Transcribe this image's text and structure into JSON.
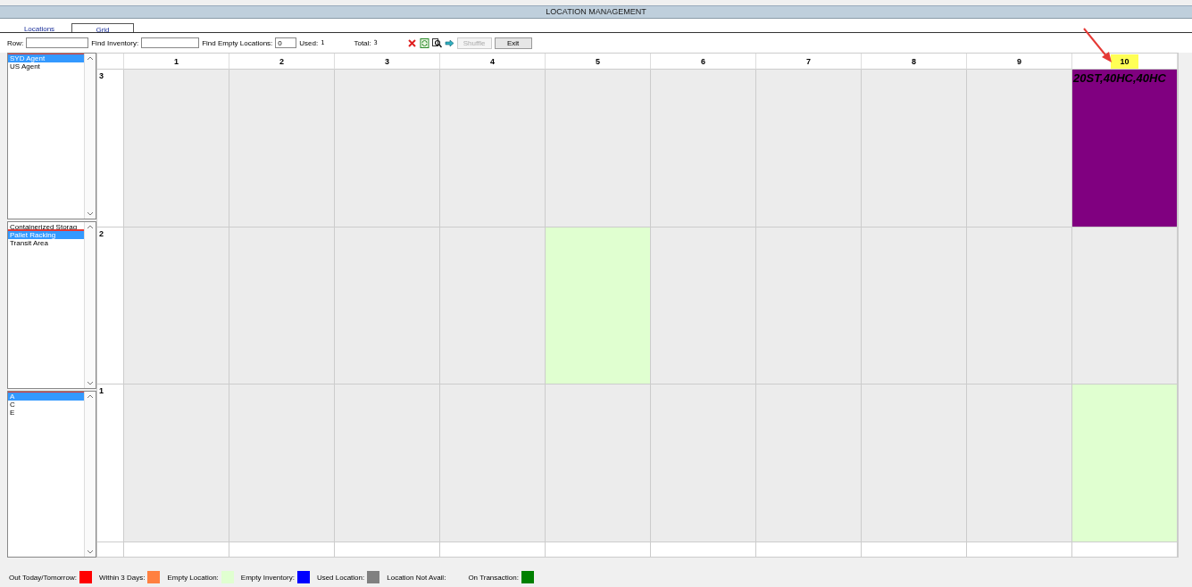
{
  "window": {
    "title": "LOCATION MANAGEMENT"
  },
  "tabs": [
    {
      "label": "Locations",
      "selected": false
    },
    {
      "label": "Grid",
      "selected": true
    }
  ],
  "toolbar": {
    "row_label": "Row:",
    "find_inventory_label": "Find Inventory:",
    "find_empty_label": "Find Empty Locations:",
    "find_empty_value": "0",
    "used_label": "Used:",
    "used_value": "1",
    "total_label": "Total:",
    "total_value": "3",
    "shuffle": {
      "label": "Shuffle",
      "disabled": true
    },
    "exit": {
      "label": "Exit",
      "disabled": false
    }
  },
  "lists": [
    {
      "items": [
        {
          "label": "SYD Agent",
          "selected": true,
          "highlighted": true
        },
        {
          "label": "US Agent",
          "selected": false,
          "highlighted": false
        }
      ]
    },
    {
      "items": [
        {
          "label": "Containerized Storag",
          "selected": false,
          "highlighted": false
        },
        {
          "label": "Pallet Racking",
          "selected": true,
          "highlighted": true
        },
        {
          "label": "Transit Area",
          "selected": false,
          "highlighted": false
        }
      ]
    },
    {
      "items": [
        {
          "label": "A",
          "selected": true,
          "highlighted": true
        },
        {
          "label": "C",
          "selected": false,
          "highlighted": false
        },
        {
          "label": "E",
          "selected": false,
          "highlighted": false
        }
      ]
    }
  ],
  "grid": {
    "columns": [
      {
        "label": "1",
        "highlighted": false
      },
      {
        "label": "2",
        "highlighted": false
      },
      {
        "label": "3",
        "highlighted": false
      },
      {
        "label": "4",
        "highlighted": false
      },
      {
        "label": "5",
        "highlighted": false
      },
      {
        "label": "6",
        "highlighted": false
      },
      {
        "label": "7",
        "highlighted": false
      },
      {
        "label": "8",
        "highlighted": false
      },
      {
        "label": "9",
        "highlighted": false
      },
      {
        "label": "10",
        "highlighted": true
      }
    ],
    "rows": [
      {
        "label": "3",
        "cells": [
          {
            "kind": "free"
          },
          {
            "kind": "free"
          },
          {
            "kind": "free"
          },
          {
            "kind": "free"
          },
          {
            "kind": "free"
          },
          {
            "kind": "free"
          },
          {
            "kind": "free"
          },
          {
            "kind": "free"
          },
          {
            "kind": "free"
          },
          {
            "kind": "occupied",
            "text": "20ST,40HC,40HC"
          }
        ]
      },
      {
        "label": "2",
        "cells": [
          {
            "kind": "free"
          },
          {
            "kind": "free"
          },
          {
            "kind": "free"
          },
          {
            "kind": "free"
          },
          {
            "kind": "empty"
          },
          {
            "kind": "free"
          },
          {
            "kind": "free"
          },
          {
            "kind": "free"
          },
          {
            "kind": "free"
          },
          {
            "kind": "free"
          }
        ]
      },
      {
        "label": "1",
        "cells": [
          {
            "kind": "free"
          },
          {
            "kind": "free"
          },
          {
            "kind": "free"
          },
          {
            "kind": "free"
          },
          {
            "kind": "free"
          },
          {
            "kind": "free"
          },
          {
            "kind": "free"
          },
          {
            "kind": "free"
          },
          {
            "kind": "free"
          },
          {
            "kind": "empty"
          }
        ]
      }
    ]
  },
  "legend": [
    {
      "label": "Out Today/Tomorrow:",
      "color": "#ff0000"
    },
    {
      "label": "Within 3 Days:",
      "color": "#ff8040"
    },
    {
      "label": "Empty Location:",
      "color": "#e0ffd0"
    },
    {
      "label": "Empty Inventory:",
      "color": "#0000ff"
    },
    {
      "label": "Used Location:",
      "color": "#808080"
    },
    {
      "label": "Location Not Avail:"
    },
    {
      "label": "On Transaction:",
      "color": "#008000"
    }
  ]
}
